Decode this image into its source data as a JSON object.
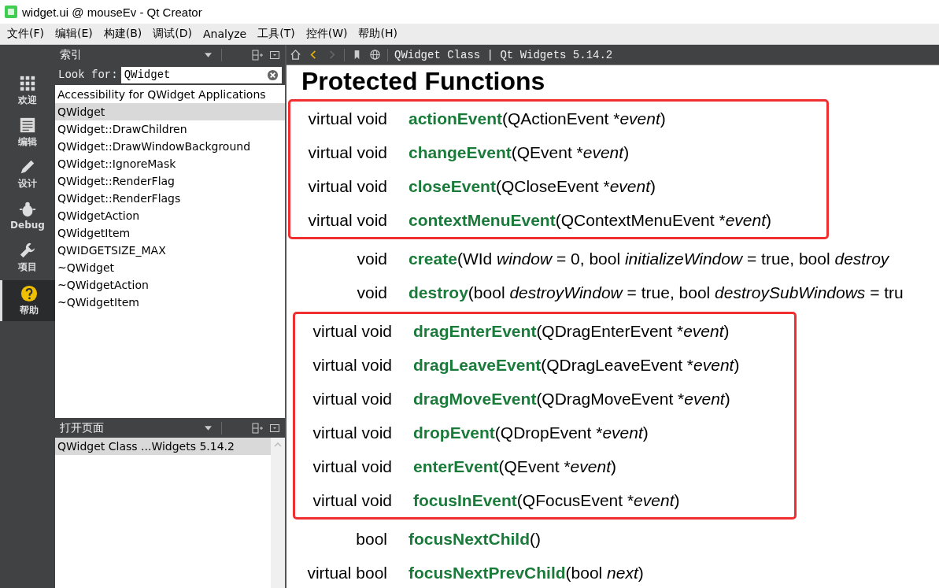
{
  "window": {
    "title": "widget.ui @ mouseEv - Qt Creator"
  },
  "menu": [
    "文件(F)",
    "编辑(E)",
    "构建(B)",
    "调试(D)",
    "Analyze",
    "工具(T)",
    "控件(W)",
    "帮助(H)"
  ],
  "modes": [
    {
      "label": "欢迎",
      "kind": "grid",
      "selected": false
    },
    {
      "label": "编辑",
      "kind": "doc",
      "selected": false
    },
    {
      "label": "设计",
      "kind": "pen",
      "selected": false
    },
    {
      "label": "Debug",
      "kind": "bug",
      "selected": false
    },
    {
      "label": "项目",
      "kind": "wrench",
      "selected": false
    },
    {
      "label": "帮助",
      "kind": "help",
      "selected": true
    }
  ],
  "index_panel": {
    "title": "索引",
    "look_for_label": "Look for:",
    "search_value": "QWidget",
    "items": [
      {
        "label": "Accessibility for QWidget Applications",
        "selected": false
      },
      {
        "label": "QWidget",
        "selected": true
      },
      {
        "label": "QWidget::DrawChildren",
        "selected": false
      },
      {
        "label": "QWidget::DrawWindowBackground",
        "selected": false
      },
      {
        "label": "QWidget::IgnoreMask",
        "selected": false
      },
      {
        "label": "QWidget::RenderFlag",
        "selected": false
      },
      {
        "label": "QWidget::RenderFlags",
        "selected": false
      },
      {
        "label": "QWidgetAction",
        "selected": false
      },
      {
        "label": "QWidgetItem",
        "selected": false
      },
      {
        "label": "QWIDGETSIZE_MAX",
        "selected": false
      },
      {
        "label": "~QWidget",
        "selected": false
      },
      {
        "label": "~QWidgetAction",
        "selected": false
      },
      {
        "label": "~QWidgetItem",
        "selected": false
      }
    ]
  },
  "open_pages_panel": {
    "title": "打开页面",
    "items": [
      {
        "label": "QWidget Class ...Widgets 5.14.2",
        "selected": true
      }
    ]
  },
  "doc_toolbar": {
    "title": "QWidget Class | Qt Widgets 5.14.2"
  },
  "doc": {
    "heading": "Protected Functions",
    "sections": [
      {
        "highlighted": true,
        "rows": [
          {
            "returns": "virtual void",
            "name": "actionEvent",
            "params": [
              {
                "kind": "plain",
                "text": "(QActionEvent *"
              },
              {
                "kind": "arg",
                "text": "event"
              },
              {
                "kind": "plain",
                "text": ")"
              }
            ]
          },
          {
            "returns": "virtual void",
            "name": "changeEvent",
            "params": [
              {
                "kind": "plain",
                "text": "(QEvent *"
              },
              {
                "kind": "arg",
                "text": "event"
              },
              {
                "kind": "plain",
                "text": ")"
              }
            ]
          },
          {
            "returns": "virtual void",
            "name": "closeEvent",
            "params": [
              {
                "kind": "plain",
                "text": "(QCloseEvent *"
              },
              {
                "kind": "arg",
                "text": "event"
              },
              {
                "kind": "plain",
                "text": ")"
              }
            ]
          },
          {
            "returns": "virtual void",
            "name": "contextMenuEvent",
            "params": [
              {
                "kind": "plain",
                "text": "(QContextMenuEvent *"
              },
              {
                "kind": "arg",
                "text": "event"
              },
              {
                "kind": "plain",
                "text": ")"
              }
            ]
          }
        ]
      },
      {
        "highlighted": false,
        "rows": [
          {
            "returns": "void",
            "name": "create",
            "params": [
              {
                "kind": "plain",
                "text": "(WId "
              },
              {
                "kind": "arg",
                "text": "window"
              },
              {
                "kind": "plain",
                "text": " = 0, bool "
              },
              {
                "kind": "arg",
                "text": "initializeWindow"
              },
              {
                "kind": "plain",
                "text": " = true, bool "
              },
              {
                "kind": "arg",
                "text": "destroy"
              }
            ]
          },
          {
            "returns": "void",
            "name": "destroy",
            "params": [
              {
                "kind": "plain",
                "text": "(bool "
              },
              {
                "kind": "arg",
                "text": "destroyWindow"
              },
              {
                "kind": "plain",
                "text": " = true, bool "
              },
              {
                "kind": "arg",
                "text": "destroySubWindows"
              },
              {
                "kind": "plain",
                "text": " = tru"
              }
            ]
          }
        ]
      },
      {
        "highlighted": true,
        "rows": [
          {
            "returns": "virtual void",
            "name": "dragEnterEvent",
            "params": [
              {
                "kind": "plain",
                "text": "(QDragEnterEvent *"
              },
              {
                "kind": "arg",
                "text": "event"
              },
              {
                "kind": "plain",
                "text": ")"
              }
            ]
          },
          {
            "returns": "virtual void",
            "name": "dragLeaveEvent",
            "params": [
              {
                "kind": "plain",
                "text": "(QDragLeaveEvent *"
              },
              {
                "kind": "arg",
                "text": "event"
              },
              {
                "kind": "plain",
                "text": ")"
              }
            ]
          },
          {
            "returns": "virtual void",
            "name": "dragMoveEvent",
            "params": [
              {
                "kind": "plain",
                "text": "(QDragMoveEvent *"
              },
              {
                "kind": "arg",
                "text": "event"
              },
              {
                "kind": "plain",
                "text": ")"
              }
            ]
          },
          {
            "returns": "virtual void",
            "name": "dropEvent",
            "params": [
              {
                "kind": "plain",
                "text": "(QDropEvent *"
              },
              {
                "kind": "arg",
                "text": "event"
              },
              {
                "kind": "plain",
                "text": ")"
              }
            ]
          },
          {
            "returns": "virtual void",
            "name": "enterEvent",
            "params": [
              {
                "kind": "plain",
                "text": "(QEvent *"
              },
              {
                "kind": "arg",
                "text": "event"
              },
              {
                "kind": "plain",
                "text": ")"
              }
            ]
          },
          {
            "returns": "virtual void",
            "name": "focusInEvent",
            "params": [
              {
                "kind": "plain",
                "text": "(QFocusEvent *"
              },
              {
                "kind": "arg",
                "text": "event"
              },
              {
                "kind": "plain",
                "text": ")"
              }
            ]
          }
        ]
      },
      {
        "highlighted": false,
        "rows": [
          {
            "returns": "bool",
            "name": "focusNextChild",
            "params": [
              {
                "kind": "plain",
                "text": "()"
              }
            ]
          },
          {
            "returns": "virtual bool",
            "name": "focusNextPrevChild",
            "params": [
              {
                "kind": "plain",
                "text": "(bool "
              },
              {
                "kind": "arg",
                "text": "next"
              },
              {
                "kind": "plain",
                "text": ")"
              }
            ]
          }
        ]
      }
    ]
  }
}
